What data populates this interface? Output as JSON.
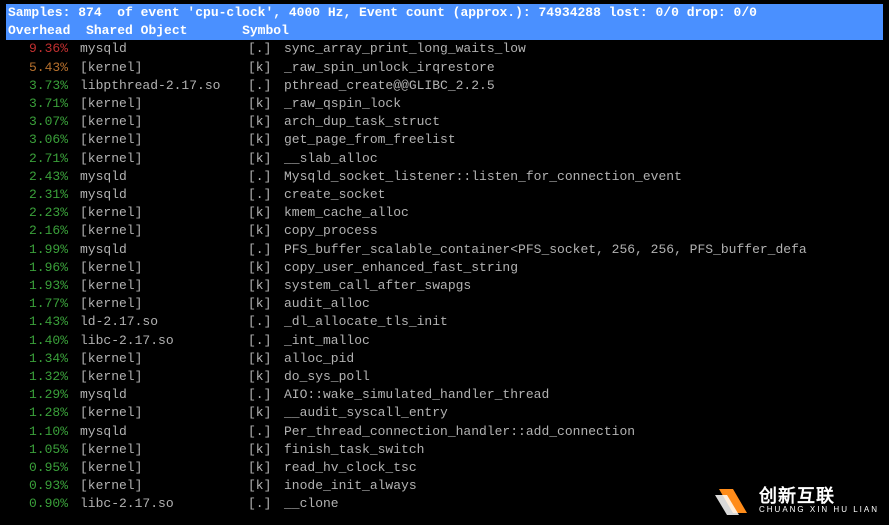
{
  "header": {
    "line1": "Samples: 874  of event 'cpu-clock', 4000 Hz, Event count (approx.): 74934288 lost: 0/0 drop: 0/0",
    "col_overhead": "Overhead",
    "col_object": "Shared Object",
    "col_symbol": "Symbol"
  },
  "rows": [
    {
      "pct": "9.36%",
      "color": "red",
      "obj": "mysqld",
      "tag": "[.]",
      "sym": "sync_array_print_long_waits_low"
    },
    {
      "pct": "5.43%",
      "color": "orange",
      "obj": "[kernel]",
      "tag": "[k]",
      "sym": "_raw_spin_unlock_irqrestore"
    },
    {
      "pct": "3.73%",
      "color": "green",
      "obj": "libpthread-2.17.so",
      "tag": "[.]",
      "sym": "pthread_create@@GLIBC_2.2.5"
    },
    {
      "pct": "3.71%",
      "color": "green",
      "obj": "[kernel]",
      "tag": "[k]",
      "sym": "_raw_qspin_lock"
    },
    {
      "pct": "3.07%",
      "color": "green",
      "obj": "[kernel]",
      "tag": "[k]",
      "sym": "arch_dup_task_struct"
    },
    {
      "pct": "3.06%",
      "color": "green",
      "obj": "[kernel]",
      "tag": "[k]",
      "sym": "get_page_from_freelist"
    },
    {
      "pct": "2.71%",
      "color": "green",
      "obj": "[kernel]",
      "tag": "[k]",
      "sym": "__slab_alloc"
    },
    {
      "pct": "2.43%",
      "color": "green",
      "obj": "mysqld",
      "tag": "[.]",
      "sym": "Mysqld_socket_listener::listen_for_connection_event"
    },
    {
      "pct": "2.31%",
      "color": "green",
      "obj": "mysqld",
      "tag": "[.]",
      "sym": "create_socket"
    },
    {
      "pct": "2.23%",
      "color": "green",
      "obj": "[kernel]",
      "tag": "[k]",
      "sym": "kmem_cache_alloc"
    },
    {
      "pct": "2.16%",
      "color": "green",
      "obj": "[kernel]",
      "tag": "[k]",
      "sym": "copy_process"
    },
    {
      "pct": "1.99%",
      "color": "green",
      "obj": "mysqld",
      "tag": "[.]",
      "sym": "PFS_buffer_scalable_container<PFS_socket, 256, 256, PFS_buffer_defa"
    },
    {
      "pct": "1.96%",
      "color": "green",
      "obj": "[kernel]",
      "tag": "[k]",
      "sym": "copy_user_enhanced_fast_string"
    },
    {
      "pct": "1.93%",
      "color": "green",
      "obj": "[kernel]",
      "tag": "[k]",
      "sym": "system_call_after_swapgs"
    },
    {
      "pct": "1.77%",
      "color": "green",
      "obj": "[kernel]",
      "tag": "[k]",
      "sym": "audit_alloc"
    },
    {
      "pct": "1.43%",
      "color": "green",
      "obj": "ld-2.17.so",
      "tag": "[.]",
      "sym": "_dl_allocate_tls_init"
    },
    {
      "pct": "1.40%",
      "color": "green",
      "obj": "libc-2.17.so",
      "tag": "[.]",
      "sym": "_int_malloc"
    },
    {
      "pct": "1.34%",
      "color": "green",
      "obj": "[kernel]",
      "tag": "[k]",
      "sym": "alloc_pid"
    },
    {
      "pct": "1.32%",
      "color": "green",
      "obj": "[kernel]",
      "tag": "[k]",
      "sym": "do_sys_poll"
    },
    {
      "pct": "1.29%",
      "color": "green",
      "obj": "mysqld",
      "tag": "[.]",
      "sym": "AIO::wake_simulated_handler_thread"
    },
    {
      "pct": "1.28%",
      "color": "green",
      "obj": "[kernel]",
      "tag": "[k]",
      "sym": "__audit_syscall_entry"
    },
    {
      "pct": "1.10%",
      "color": "green",
      "obj": "mysqld",
      "tag": "[.]",
      "sym": "Per_thread_connection_handler::add_connection"
    },
    {
      "pct": "1.05%",
      "color": "green",
      "obj": "[kernel]",
      "tag": "[k]",
      "sym": "finish_task_switch"
    },
    {
      "pct": "0.95%",
      "color": "green",
      "obj": "[kernel]",
      "tag": "[k]",
      "sym": "read_hv_clock_tsc"
    },
    {
      "pct": "0.93%",
      "color": "green",
      "obj": "[kernel]",
      "tag": "[k]",
      "sym": "inode_init_always"
    },
    {
      "pct": "0.90%",
      "color": "green",
      "obj": "libc-2.17.so",
      "tag": "[.]",
      "sym": "__clone"
    }
  ],
  "watermark": {
    "cn": "创新互联",
    "en": "CHUANG XIN HU LIAN"
  }
}
